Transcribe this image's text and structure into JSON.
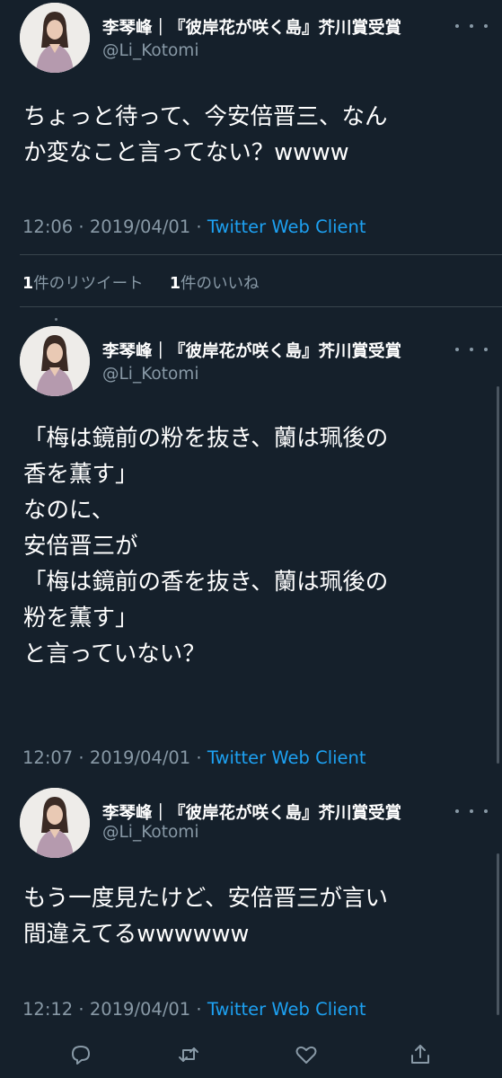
{
  "author": {
    "name": "李琴峰｜『彼岸花が咲く島』芥川賞受賞",
    "handle": "@Li_Kotomi",
    "avatar_icon": "profile-photo-avatar"
  },
  "tweets": [
    {
      "lines": [
        "ちょっと待って、今安倍晋三、なん",
        "か変なこと言ってない？wwww"
      ],
      "time": "12:06",
      "date": "2019/04/01",
      "client": "Twitter Web Client"
    },
    {
      "lines": [
        "「梅は鏡前の粉を抜き、蘭は珮後の",
        "香を薫す」",
        "なのに、",
        "安倍晋三が",
        "「梅は鏡前の香を抜き、蘭は珮後の",
        "粉を薫す」",
        "と言っていない？"
      ],
      "time": "12:07",
      "date": "2019/04/01",
      "client": "Twitter Web Client"
    },
    {
      "lines": [
        "もう一度見たけど、安倍晋三が言い",
        "間違えてるwwwwww"
      ],
      "time": "12:12",
      "date": "2019/04/01",
      "client": "Twitter Web Client"
    }
  ],
  "stats": {
    "retweets_count": "1",
    "retweets_label": "件のリツイート",
    "likes_count": "1",
    "likes_label": "件のいいね"
  },
  "separator": "·",
  "actions": [
    "reply-icon",
    "retweet-icon",
    "like-icon",
    "share-icon"
  ],
  "colors": {
    "background": "#15202b",
    "text": "#ffffff",
    "secondary": "#8899a6",
    "link": "#1da1f2",
    "divider": "#38444d"
  }
}
